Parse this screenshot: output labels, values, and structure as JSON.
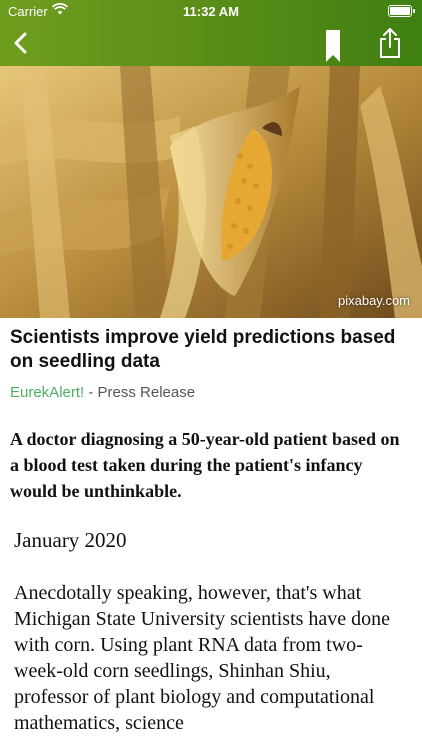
{
  "status_bar": {
    "carrier": "Carrier",
    "time": "11:32 AM"
  },
  "nav": {
    "back_icon": "chevron-left-icon",
    "bookmark_icon": "bookmark-icon",
    "share_icon": "share-icon",
    "bar_color": "#5d8f18"
  },
  "hero": {
    "credit": "pixabay.com"
  },
  "article": {
    "title": "Scientists improve yield predictions based on seedling data",
    "source_name": "EurekAlert!",
    "source_suffix": " - Press Release",
    "lead": "A doctor diagnosing a 50-year-old patient based on a blood test taken during the patient's infancy would be unthinkable.",
    "date": "January 2020",
    "body": "Anecdotally speaking, however, that's what Michigan State University scientists have done with corn. Using plant RNA data from two-week-old corn seedlings, Shinhan Shiu, professor of plant biology and computational mathematics, science"
  },
  "colors": {
    "source_link": "#4caf63"
  }
}
